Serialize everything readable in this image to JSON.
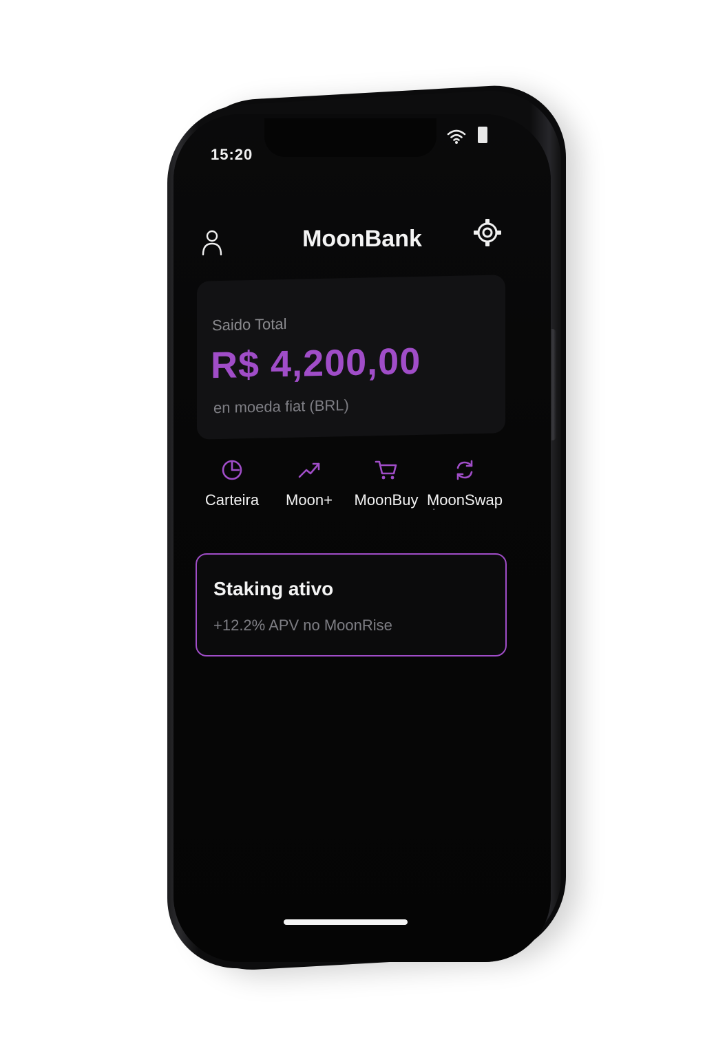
{
  "status_bar": {
    "time": "15:20",
    "wifi_icon": "wifi-icon",
    "battery_icon": "battery-icon"
  },
  "header": {
    "title": "MoonBank",
    "profile_icon": "user-icon",
    "settings_icon": "gear-icon"
  },
  "balance": {
    "label": "Saido Total",
    "value": "R$ 4,200,00",
    "sub": "en moeda fiat (BRL)"
  },
  "actions": [
    {
      "label": "Carteira",
      "icon": "pie-chart-icon"
    },
    {
      "label": "Moon+",
      "icon": "trending-up-icon"
    },
    {
      "label": "MoonBuy",
      "icon": "cart-icon"
    },
    {
      "label": "MoonSwap",
      "icon": "swap-icon"
    }
  ],
  "actions_separator": ":",
  "staking": {
    "title": "Staking ativo",
    "sub": "+12.2% APV no MoonRise"
  },
  "colors": {
    "accent": "#a04dc8",
    "background": "#080808",
    "card": "#121214",
    "text": "#f4f4f4",
    "muted": "#7e7e84"
  }
}
